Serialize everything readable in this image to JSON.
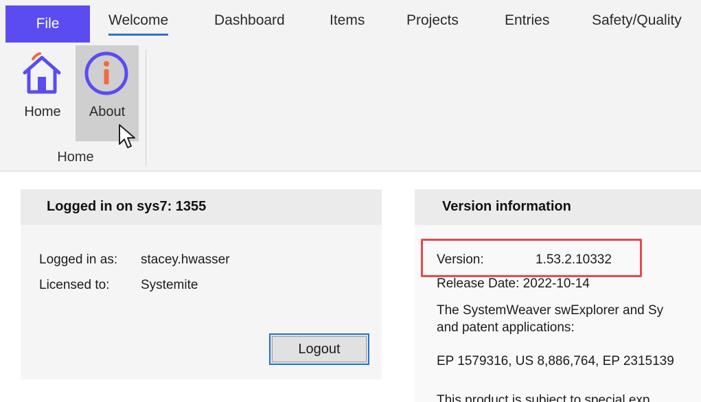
{
  "tabs": {
    "file": "File",
    "items": [
      "Welcome",
      "Dashboard",
      "Items",
      "Projects",
      "Entries",
      "Safety/Quality"
    ],
    "active": "Welcome"
  },
  "ribbon": {
    "home_button": "Home",
    "about_button": "About",
    "group_label": "Home",
    "home_icon": "home-icon",
    "about_icon": "info-icon"
  },
  "login_panel": {
    "title": "Logged in on sys7: 1355",
    "logged_in_as_label": "Logged in as:",
    "logged_in_as_value": "stacey.hwasser",
    "licensed_to_label": "Licensed to:",
    "licensed_to_value": "Systemite",
    "logout_button": "Logout"
  },
  "version_panel": {
    "title": "Version information",
    "version_label": "Version:",
    "version_value": "1.53.2.10332",
    "release_date": "Release Date: 2022-10-14",
    "description_line1": "The SystemWeaver swExplorer and Sy",
    "description_line2": "and patent applications:",
    "patents": "EP 1579316, US 8,886,764, EP 2315139",
    "notice": "This product is subject to special exp"
  },
  "colors": {
    "file_tab": "#5a4cf0",
    "active_tab_underline": "#2a6fdb",
    "highlight_box": "#e8484d",
    "icon_primary": "#5a4cf0",
    "icon_accent": "#f26a3c"
  }
}
